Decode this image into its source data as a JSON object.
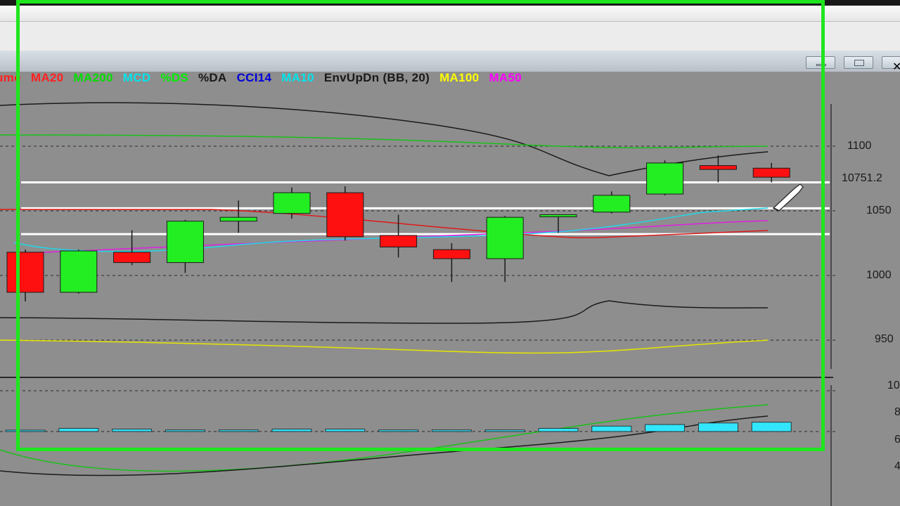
{
  "window": {
    "controls": [
      "minimize-button",
      "restore-button",
      "close-button"
    ]
  },
  "legend": [
    {
      "label": "ume",
      "color": "#ff2020"
    },
    {
      "label": "MA20",
      "color": "#ff2020"
    },
    {
      "label": "MA200",
      "color": "#00dd00"
    },
    {
      "label": "MCD",
      "color": "#00e5ee"
    },
    {
      "label": "%DS",
      "color": "#00ee00"
    },
    {
      "label": "%DA",
      "color": "#1a1a1a"
    },
    {
      "label": "CCI14",
      "color": "#0000dd"
    },
    {
      "label": "MA10",
      "color": "#00e5ee"
    },
    {
      "label": "EnvUpDn (BB, 20)",
      "color": "#1a1a1a"
    },
    {
      "label": "MA100",
      "color": "#ffff00"
    },
    {
      "label": "MA50",
      "color": "#ff00ff"
    }
  ],
  "price_axis": {
    "labels": [
      "1100",
      "10751.2",
      "1050",
      "1000",
      "950"
    ],
    "label_colors": {
      "normal": "#1a1a1a"
    }
  },
  "lower_axis": {
    "labels": [
      "10",
      "8",
      "6",
      "4"
    ]
  },
  "chart_data": {
    "type": "candlestick",
    "price_ticks": [
      11000,
      10500,
      10000,
      9500
    ],
    "current_price": 10751.2,
    "candles": [
      {
        "open": 10180,
        "close": 9870,
        "high": 10200,
        "low": 9800,
        "bull": false
      },
      {
        "open": 9870,
        "close": 10190,
        "high": 10200,
        "low": 9860,
        "bull": true
      },
      {
        "open": 10180,
        "close": 10100,
        "high": 10350,
        "low": 10080,
        "bull": false
      },
      {
        "open": 10100,
        "close": 10420,
        "high": 10430,
        "low": 10020,
        "bull": true
      },
      {
        "open": 10420,
        "close": 10450,
        "high": 10580,
        "low": 10330,
        "bull": true
      },
      {
        "open": 10480,
        "close": 10640,
        "high": 10680,
        "low": 10440,
        "bull": true
      },
      {
        "open": 10640,
        "close": 10300,
        "high": 10690,
        "low": 10270,
        "bull": false
      },
      {
        "open": 10310,
        "close": 10220,
        "high": 10470,
        "low": 10140,
        "bull": false
      },
      {
        "open": 10200,
        "close": 10130,
        "high": 10250,
        "low": 9950,
        "bull": false
      },
      {
        "open": 10130,
        "close": 10450,
        "high": 10460,
        "low": 9950,
        "bull": true
      },
      {
        "open": 10470,
        "close": 10470,
        "high": 10470,
        "low": 10330,
        "bull": true
      },
      {
        "open": 10490,
        "close": 10620,
        "high": 10650,
        "low": 10480,
        "bull": true
      },
      {
        "open": 10630,
        "close": 10870,
        "high": 10890,
        "low": 10620,
        "bull": true
      },
      {
        "open": 10850,
        "close": 10820,
        "high": 10930,
        "low": 10720,
        "bull": false
      },
      {
        "open": 10830,
        "close": 10760,
        "high": 10870,
        "low": 10720,
        "bull": false
      }
    ],
    "horizontal_levels": [
      10720,
      10520,
      10320
    ],
    "histogram": [
      0,
      0.2,
      0.15,
      0.1,
      0.1,
      0.15,
      0.15,
      0.1,
      0.1,
      0.1,
      0.2,
      0.35,
      0.45,
      0.55,
      0.6
    ],
    "colors": {
      "bull": "#22ee22",
      "bear": "#ff1010",
      "histogram": "#33e6ff",
      "highlight": "#1ee61e"
    }
  }
}
